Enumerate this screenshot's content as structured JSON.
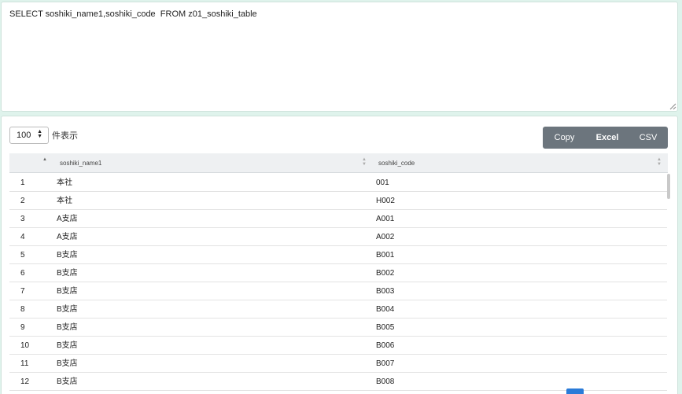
{
  "query": {
    "text": "SELECT soshiki_name1,soshiki_code  FROM z01_soshiki_table"
  },
  "controls": {
    "length_value": "100",
    "length_label": "件表示",
    "buttons": {
      "copy": "Copy",
      "excel": "Excel",
      "csv": "CSV"
    }
  },
  "table": {
    "columns": [
      "",
      "soshiki_name1",
      "soshiki_code"
    ],
    "rows": [
      [
        "1",
        "本社",
        "001"
      ],
      [
        "2",
        "本社",
        "H002"
      ],
      [
        "3",
        "A支店",
        "A001"
      ],
      [
        "4",
        "A支店",
        "A002"
      ],
      [
        "5",
        "B支店",
        "B001"
      ],
      [
        "6",
        "B支店",
        "B002"
      ],
      [
        "7",
        "B支店",
        "B003"
      ],
      [
        "8",
        "B支店",
        "B004"
      ],
      [
        "9",
        "B支店",
        "B005"
      ],
      [
        "10",
        "B支店",
        "B006"
      ],
      [
        "11",
        "B支店",
        "B007"
      ],
      [
        "12",
        "B支店",
        "B008"
      ]
    ]
  },
  "colors": {
    "background": "#dff3ec",
    "button_group": "#6c757d",
    "header_bg": "#eef0f2",
    "pager_active": "#2a7bd8"
  }
}
